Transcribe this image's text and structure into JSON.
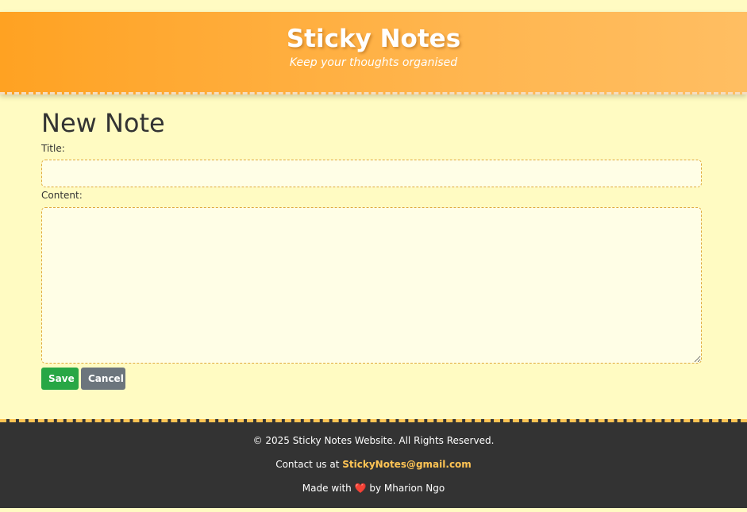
{
  "header": {
    "title": "Sticky Notes",
    "tagline": "Keep your thoughts organised"
  },
  "form": {
    "heading": "New Note",
    "title_label": "Title:",
    "title_value": "",
    "content_label": "Content:",
    "content_value": "",
    "save_label": "Save",
    "cancel_label": "Cancel"
  },
  "footer": {
    "copyright": "© 2025 Sticky Notes Website. All Rights Reserved.",
    "contact_prefix": "Contact us at",
    "contact_email": "StickyNotes@gmail.com",
    "made_prefix": "Made with",
    "heart": "❤️",
    "made_suffix": "by Mharion Ngo"
  },
  "colors": {
    "header_gradient_start": "#ffa222",
    "header_gradient_end": "#ffbe62",
    "page_background": "#fffbc2",
    "save_button": "#28a745",
    "cancel_button": "#6c757d",
    "footer_background": "#333333",
    "accent": "#ffc454"
  }
}
